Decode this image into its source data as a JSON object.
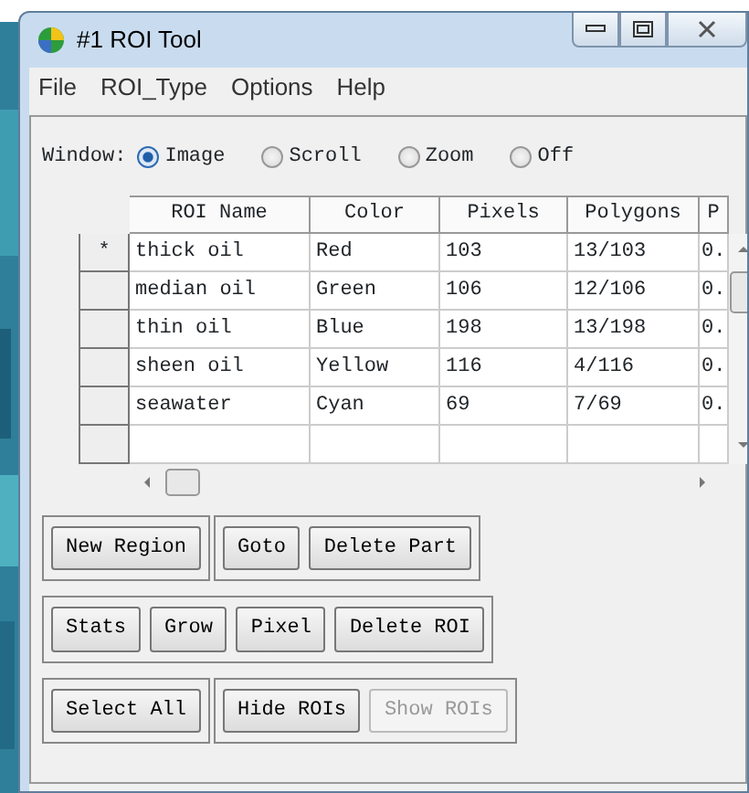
{
  "window": {
    "title": "#1 ROI Tool"
  },
  "menu": [
    "File",
    "ROI_Type",
    "Options",
    "Help"
  ],
  "window_option": {
    "label": "Window:",
    "options": [
      {
        "label": "Image",
        "selected": true
      },
      {
        "label": "Scroll",
        "selected": false
      },
      {
        "label": "Zoom",
        "selected": false
      },
      {
        "label": "Off",
        "selected": false
      }
    ]
  },
  "table": {
    "columns": [
      "ROI Name",
      "Color",
      "Pixels",
      "Polygons",
      "P"
    ],
    "rows": [
      {
        "marker": "*",
        "cells": [
          "thick oil",
          "Red",
          "103",
          "13/103",
          "0."
        ]
      },
      {
        "cells": [
          "median oil",
          "Green",
          "106",
          "12/106",
          "0."
        ]
      },
      {
        "cells": [
          "thin oil",
          "Blue",
          "198",
          "13/198",
          "0."
        ]
      },
      {
        "cells": [
          "sheen oil",
          "Yellow",
          "116",
          "4/116",
          "0."
        ]
      },
      {
        "cells": [
          "seawater",
          "Cyan",
          "69",
          "7/69",
          "0."
        ]
      }
    ]
  },
  "button_rows": [
    [
      [
        {
          "label": "New Region",
          "disabled": false
        }
      ],
      [
        {
          "label": "Goto",
          "disabled": false
        },
        {
          "label": "Delete Part",
          "disabled": false
        }
      ]
    ],
    [
      [
        {
          "label": "Stats",
          "disabled": false
        },
        {
          "label": "Grow",
          "disabled": false
        },
        {
          "label": "Pixel",
          "disabled": false
        },
        {
          "label": "Delete ROI",
          "disabled": false
        }
      ]
    ],
    [
      [
        {
          "label": "Select All",
          "disabled": false
        }
      ],
      [
        {
          "label": "Hide ROIs",
          "disabled": false
        },
        {
          "label": "Show ROIs",
          "disabled": true
        }
      ]
    ]
  ]
}
